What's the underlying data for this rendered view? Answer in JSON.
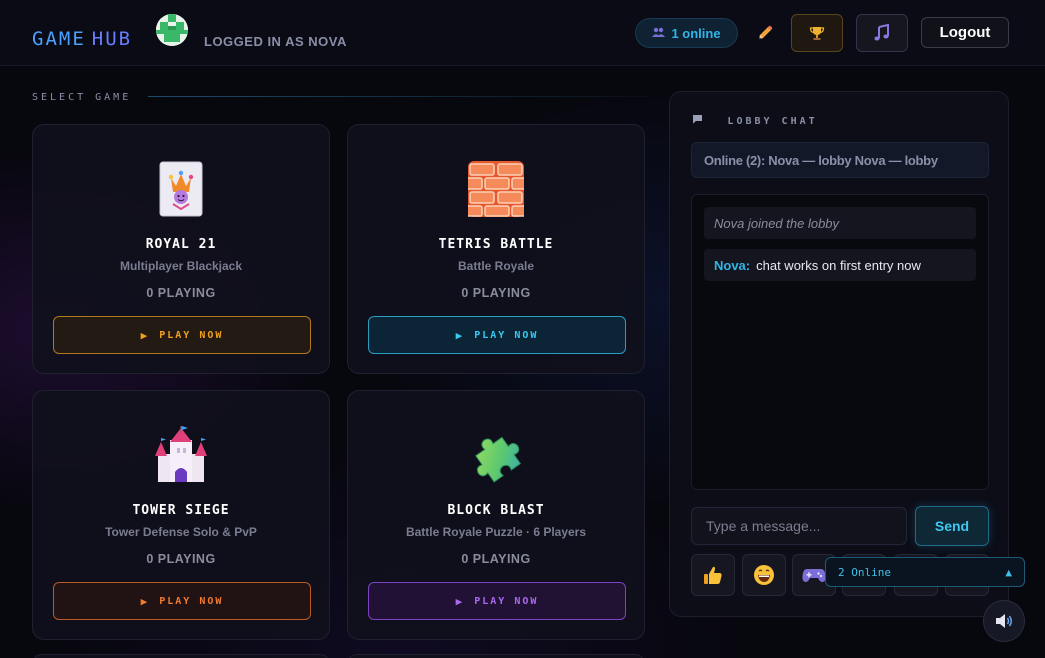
{
  "header": {
    "logo_part1": "GAME",
    "logo_part2": "HUB",
    "user_label": "LOGGED IN AS NOVA",
    "online_count": "1 online",
    "logout_label": "Logout",
    "icons": [
      "people-icon",
      "pencil-icon",
      "trophy-icon",
      "music-note-icon"
    ]
  },
  "section": {
    "label": "SELECT GAME"
  },
  "games": [
    {
      "title": "ROYAL 21",
      "subtitle": "Multiplayer Blackjack",
      "count": "0 PLAYING",
      "button": "PLAY NOW",
      "icon": "joker-card-icon",
      "accent": "#f0a020"
    },
    {
      "title": "TETRIS BATTLE",
      "subtitle": "Battle Royale",
      "count": "0 PLAYING",
      "button": "PLAY NOW",
      "icon": "brick-icon",
      "accent": "#39c8f0"
    },
    {
      "title": "TOWER SIEGE",
      "subtitle": "Tower Defense Solo & PvP",
      "count": "0 PLAYING",
      "button": "PLAY NOW",
      "icon": "castle-icon",
      "accent": "#f07a30"
    },
    {
      "title": "BLOCK BLAST",
      "subtitle": "Battle Royale Puzzle · 6 Players",
      "count": "0 PLAYING",
      "button": "PLAY NOW",
      "icon": "puzzle-piece-icon",
      "accent": "#a868f0"
    }
  ],
  "chat": {
    "title": "LOBBY CHAT",
    "online_list": "Online (2): Nova — lobby Nova — lobby",
    "messages": [
      {
        "type": "system",
        "text": "Nova joined the lobby"
      },
      {
        "type": "user",
        "author": "Nova:",
        "text": "chat works on first entry now"
      }
    ],
    "input_placeholder": "Type a message...",
    "send_label": "Send",
    "emojis": [
      "thumbs-up-icon",
      "grinning-face-icon",
      "game-controller-icon"
    ]
  },
  "online_popup": {
    "label": "2 Online",
    "caret": "▲"
  },
  "colors": {
    "accent_cyan": "#2fb6e8",
    "accent_blue": "#4aa0ff",
    "background": "#07070e"
  }
}
